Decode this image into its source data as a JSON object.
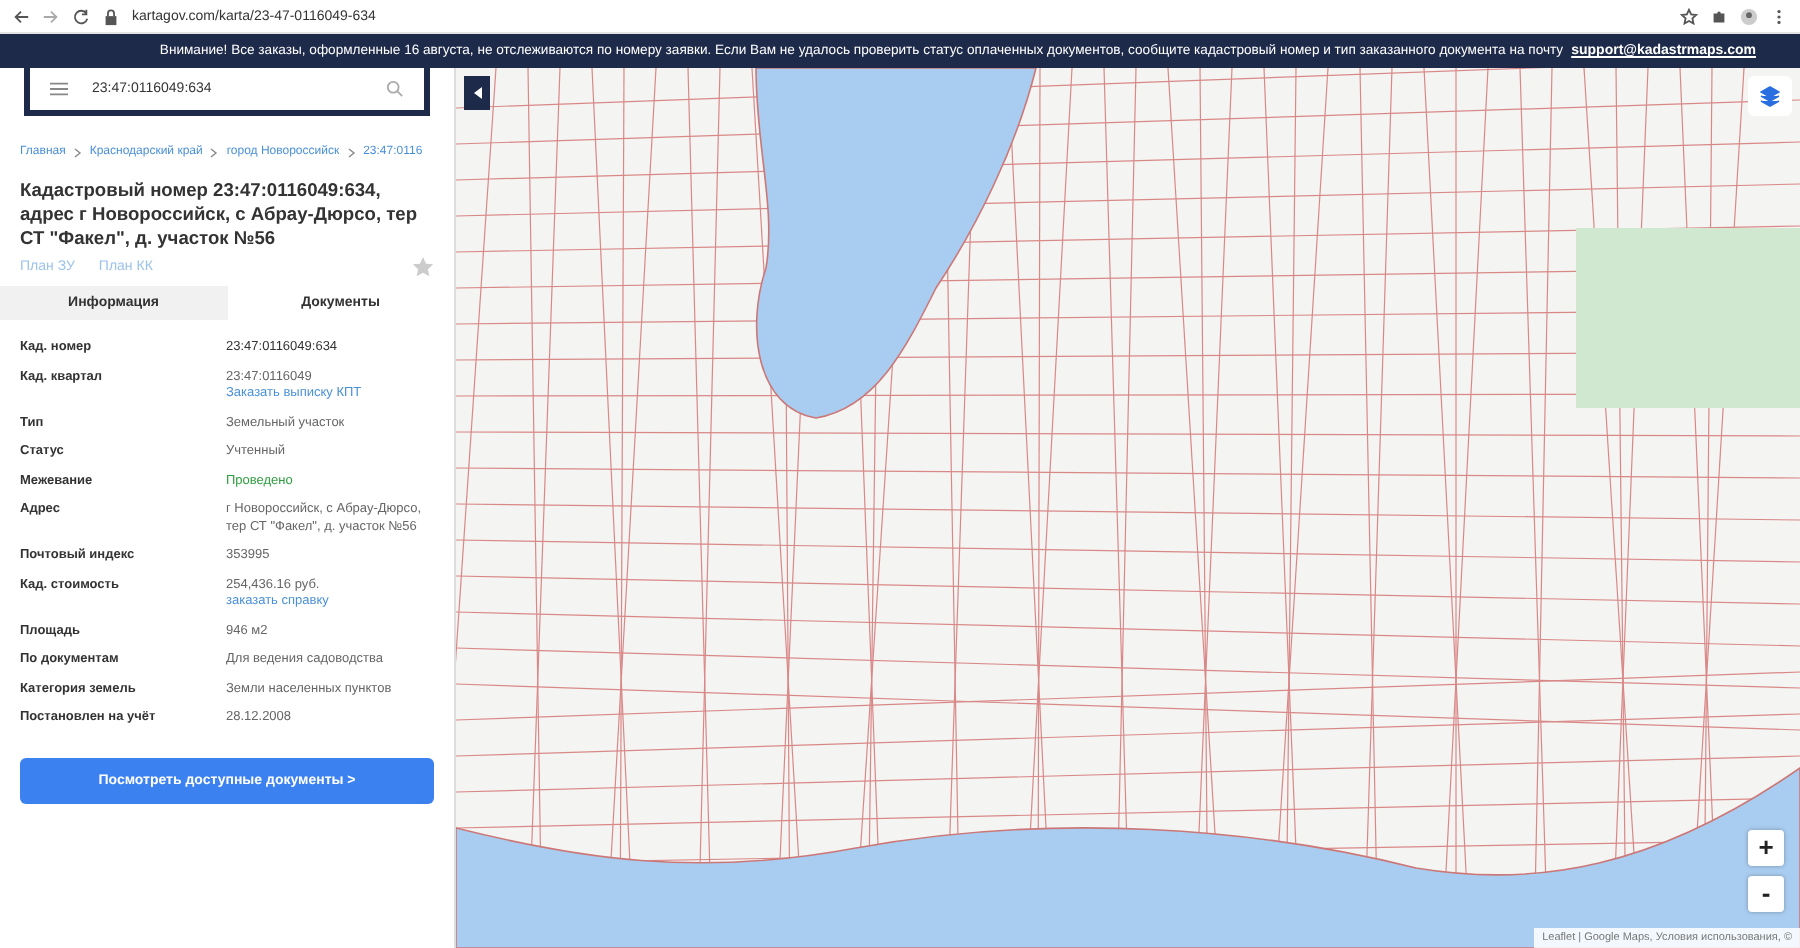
{
  "browser": {
    "url": "kartagov.com/karta/23-47-0116049-634"
  },
  "notice": {
    "text": "Внимание! Все заказы, оформленные 16 августа, не отслеживаются по номеру заявки. Если Вам не удалось проверить статус оплаченных документов, сообщите кадастровый номер и тип заказанного документа на почту",
    "email": "support@kadastrmaps.com"
  },
  "search": {
    "value": "23:47:0116049:634"
  },
  "breadcrumbs": [
    "Главная",
    "Краснодарский край",
    "город Новороссийск",
    "23:47:0116"
  ],
  "title": "Кадастровый номер 23:47:0116049:634, адрес г Новороссийск, с Абрау-Дюрсо, тер СТ \"Факел\", д. участок №56",
  "plan_links": [
    "План ЗУ",
    "План КК"
  ],
  "favorite": {
    "on": false
  },
  "tabs": [
    {
      "label": "Информация",
      "selected": true
    },
    {
      "label": "Документы",
      "selected": false
    }
  ],
  "rows": [
    {
      "label": "Кад. номер",
      "value": "23:47:0116049:634",
      "kind": "strong"
    },
    {
      "label": "Кад. квартал",
      "value": "23:47:0116049",
      "link": "Заказать выписку КПТ",
      "kind": "plain"
    },
    {
      "label": "Тип",
      "value": "Земельный участок",
      "kind": "plain"
    },
    {
      "label": "Статус",
      "value": "Учтенный",
      "kind": "plain"
    },
    {
      "label": "Межевание",
      "value": "Проведено",
      "kind": "success"
    },
    {
      "label": "Адрес",
      "value": "г Новороссийск, с Абрау-Дюрсо, тер СТ \"Факел\", д. участок №56",
      "kind": "plain"
    },
    {
      "label": "Почтовый индекс",
      "value": "353995",
      "kind": "plain"
    },
    {
      "label": "Кад. стоимость",
      "value": "254,436.16 руб.",
      "link": "заказать справку",
      "kind": "plain"
    },
    {
      "label": "Площадь",
      "value": "946 м2",
      "kind": "plain"
    },
    {
      "label": "По документам",
      "value": "Для ведения садоводства",
      "kind": "plain"
    },
    {
      "label": "Категория земель",
      "value": "Земли населенных пунктов",
      "kind": "plain"
    },
    {
      "label": "Постановлен на учёт",
      "value": "28.12.2008",
      "kind": "plain"
    }
  ],
  "action_button": "Посмотреть доступные документы >",
  "map": {
    "zoom_in": "+",
    "zoom_out": "-",
    "attribution": "Leaflet | Google Maps, Условия использования, ©"
  }
}
